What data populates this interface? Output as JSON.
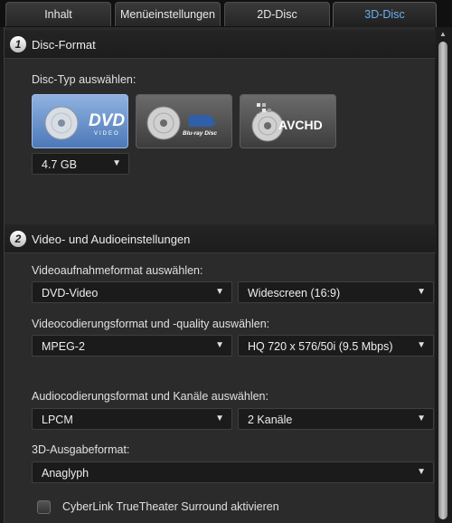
{
  "tabs": [
    {
      "label": "Inhalt"
    },
    {
      "label": "Menüeinstellungen"
    },
    {
      "label": "2D-Disc"
    },
    {
      "label": "3D-Disc",
      "active": true
    }
  ],
  "section1": {
    "number": "1",
    "title": "Disc-Format",
    "disc_type_label": "Disc-Typ auswählen:",
    "disc_options": [
      {
        "name": "DVD",
        "sub": "VIDEO",
        "selected": true
      },
      {
        "name": "Blu-ray Disc",
        "selected": false
      },
      {
        "name": "AVCHD",
        "selected": false
      }
    ],
    "capacity": {
      "value": "4.7 GB"
    }
  },
  "section2": {
    "number": "2",
    "title": "Video- und Audioeinstellungen",
    "video_format_label": "Videoaufnahmeformat auswählen:",
    "video_format": "DVD-Video",
    "aspect_ratio": "Widescreen (16:9)",
    "codec_label": "Videocodierungsformat und -quality auswählen:",
    "codec": "MPEG-2",
    "quality": "HQ 720 x 576/50i (9.5 Mbps)",
    "audio_label": "Audiocodierungsformat und Kanäle auswählen:",
    "audio_format": "LPCM",
    "audio_channels": "2 Kanäle",
    "output_label": "3D-Ausgabeformat:",
    "output_format": "Anaglyph",
    "surround_label": "CyberLink TrueTheater Surround aktivieren",
    "surround_checked": false
  },
  "colors": {
    "accent": "#6ab0f0",
    "selected_disc": "#4d79b8"
  }
}
